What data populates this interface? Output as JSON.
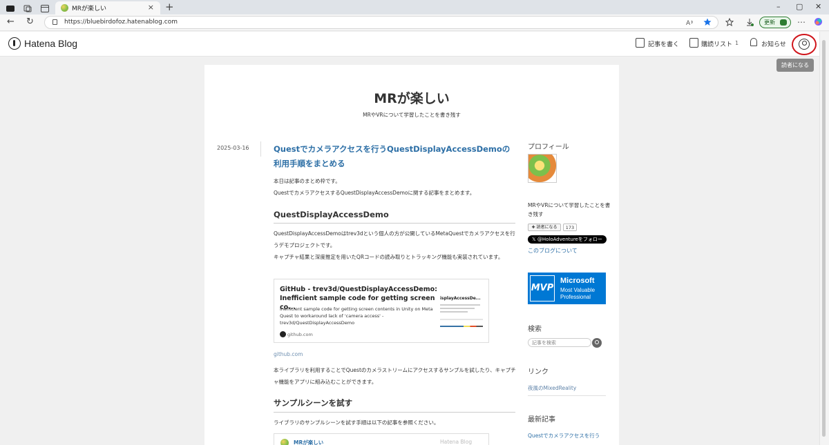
{
  "browser": {
    "tab_title": "MRが楽しい",
    "tab_close": "×",
    "new_tab": "+",
    "url": "https://bluebirdofoz.hatenablog.com",
    "update_label": "更新",
    "window_controls": [
      "–",
      "▢",
      "✕"
    ],
    "nav": {
      "back": "←",
      "reload": "↻"
    }
  },
  "hatena_header": {
    "logo": "Hatena Blog",
    "write_label": "記事を書く",
    "reading_list_label": "購読リスト",
    "reading_list_count": "1",
    "notifications_label": "お知らせ",
    "tooltip": "読者になる"
  },
  "blog": {
    "title": "MRが楽しい",
    "description": "MRやVRについて学習したことを書き残す"
  },
  "entry": {
    "date": "2025-03-16",
    "title": "Questでカメラアクセスを行うQuestDisplayAccessDemoの利用手順をまとめる",
    "intro_1": "本日は記事のまとめ枠です。",
    "intro_2": "QuestでカメラアクセスするQuestDisplayAccessDemoに関する記事をまとめます。",
    "h2_1": "QuestDisplayAccessDemo",
    "para_1": "QuestDisplayAccessDemoはtrev3dという個人の方が公開しているMetaQuestでカメラアクセスを行うデモプロジェクトです。",
    "para_2": "キャプチャ結果と深度推定を用いたQRコードの読み取りとトラッキング機能も実装されています。",
    "card": {
      "title": "GitHub - trev3d/QuestDisplayAccessDemo: Inefficient sample code for getting screen co...",
      "description": "Inefficient sample code for getting screen contents in Unity on Meta Quest to workaround lack of 'camera access' - trev3d/QuestDisplayAccessDemo",
      "site": "github.com",
      "thumb_title": "isplayAccessDe..."
    },
    "link_caption": "github.com",
    "para_3": "本ライブラリを利用することでQuestのカメラストリームにアクセスするサンプルを試したり、キャプチャ機能をアプリに組み込むことができます。",
    "h2_2": "サンプルシーンを試す",
    "para_4": "ライブラリのサンプルシーンを試す手順は以下の記事を参照ください。",
    "card2_title": "MRが楽しい",
    "card2_brand": "Hatena Blog"
  },
  "sidebar": {
    "profile_heading": "プロフィール",
    "profile_text": "MRやVRについて学習したことを書き残す",
    "reader_button": "✚ 読者になる",
    "reader_count": "173",
    "x_follow": "𝕏 @HoloAdventureをフォロー",
    "about_link": "このブログについて",
    "mvp_badge": "MVP",
    "mvp_line1": "Microsoft",
    "mvp_line2": "Most Valuable Professional",
    "search_heading": "検索",
    "search_placeholder": "記事を検索",
    "links_heading": "リンク",
    "link_1": "夜風のMixedReality",
    "recent_heading": "最新記事",
    "recent_1": "Questでカメラアクセスを行う"
  }
}
